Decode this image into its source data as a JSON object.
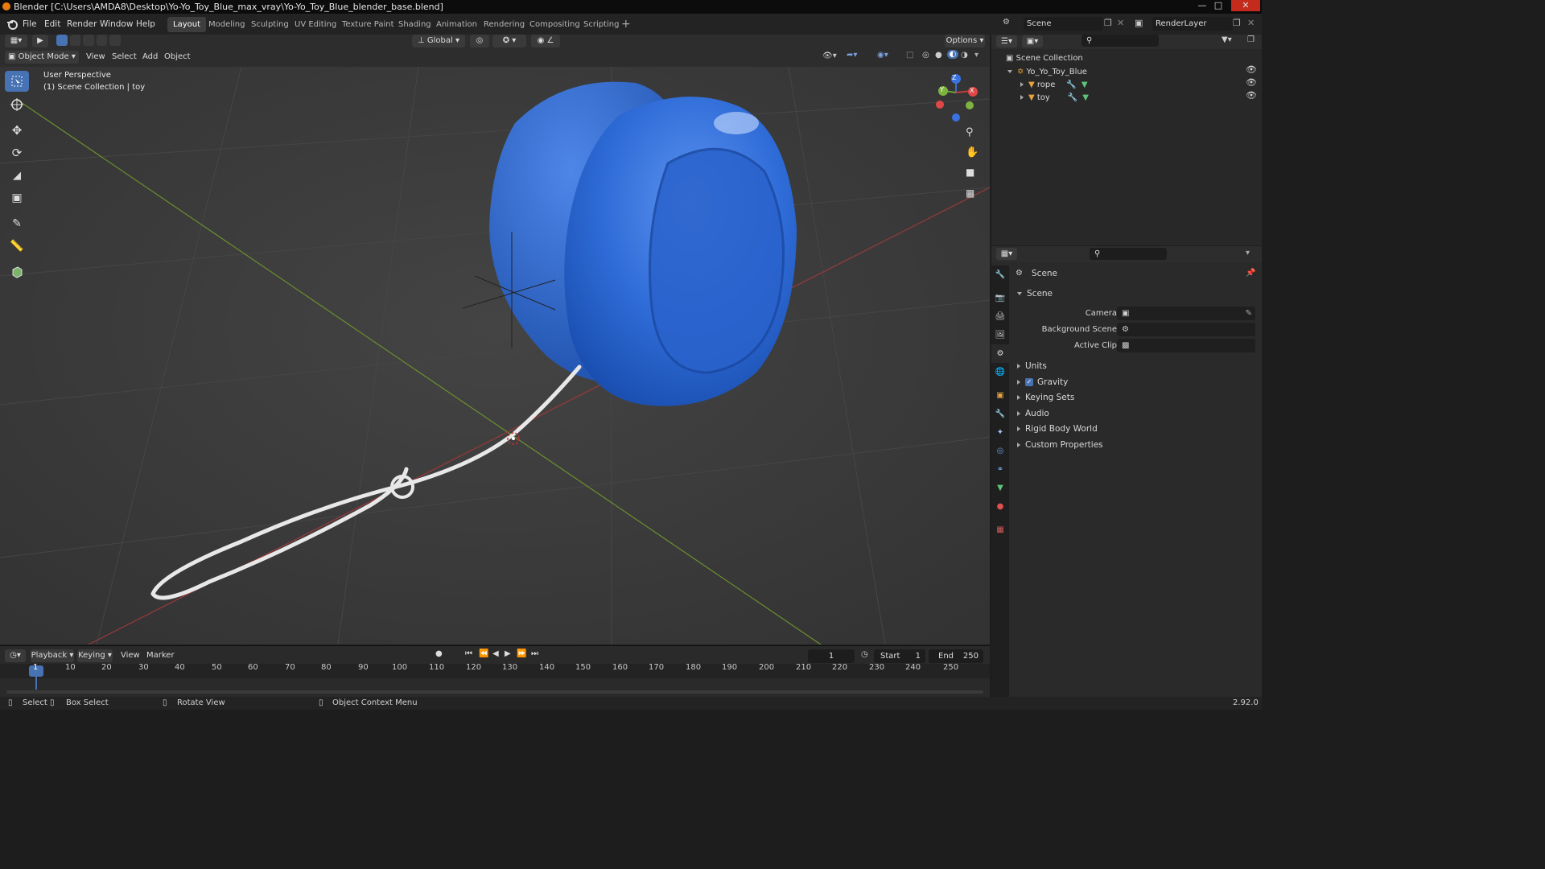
{
  "window": {
    "title": "Blender [C:\\Users\\AMDA8\\Desktop\\Yo-Yo_Toy_Blue_max_vray\\Yo-Yo_Toy_Blue_blender_base.blend]"
  },
  "menu": {
    "items": [
      "File",
      "Edit",
      "Render",
      "Window",
      "Help"
    ]
  },
  "workspaces": [
    "Layout",
    "Modeling",
    "Sculpting",
    "UV Editing",
    "Texture Paint",
    "Shading",
    "Animation",
    "Rendering",
    "Compositing",
    "Scripting"
  ],
  "active_workspace": "Layout",
  "scene_field": "Scene",
  "renderlayer_field": "RenderLayer",
  "header": {
    "orientation": "Global",
    "options": "Options",
    "mode": "Object Mode",
    "menus": [
      "View",
      "Select",
      "Add",
      "Object"
    ]
  },
  "viewport": {
    "perspective": "User Perspective",
    "collection_info": "(1) Scene Collection | toy"
  },
  "gizmo": {
    "z": "Z",
    "y": "Y",
    "x": "X"
  },
  "outliner": {
    "root": "Scene Collection",
    "items": [
      {
        "label": "Yo_Yo_Toy_Blue",
        "level": 1
      },
      {
        "label": "rope",
        "level": 2
      },
      {
        "label": "toy",
        "level": 2
      }
    ]
  },
  "properties": {
    "header": "Scene",
    "section": "Scene",
    "fields": [
      {
        "label": "Camera",
        "value": ""
      },
      {
        "label": "Background Scene",
        "value": ""
      },
      {
        "label": "Active Clip",
        "value": ""
      }
    ],
    "panels": [
      "Units",
      "Gravity",
      "Keying Sets",
      "Audio",
      "Rigid Body World",
      "Custom Properties"
    ],
    "gravity_checked": true
  },
  "timeline": {
    "menus": [
      "Playback",
      "Keying",
      "View",
      "Marker"
    ],
    "current_frame": "1",
    "start_label": "Start",
    "start": "1",
    "end_label": "End",
    "end": "250",
    "ticks": [
      "1",
      "10",
      "20",
      "30",
      "40",
      "50",
      "60",
      "70",
      "80",
      "90",
      "100",
      "110",
      "120",
      "130",
      "140",
      "150",
      "160",
      "170",
      "180",
      "190",
      "200",
      "210",
      "220",
      "230",
      "240",
      "250"
    ]
  },
  "status": {
    "select": "Select",
    "box_select": "Box Select",
    "rotate": "Rotate View",
    "context_menu": "Object Context Menu",
    "version": "2.92.0"
  }
}
